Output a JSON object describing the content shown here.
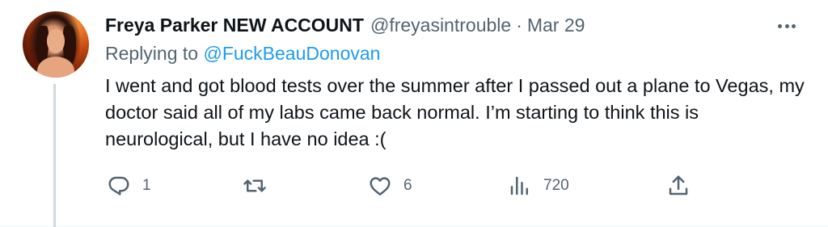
{
  "tweet": {
    "display_name": "Freya Parker NEW ACCOUNT",
    "handle": "@freyasintrouble",
    "separator": "·",
    "date": "Mar 29",
    "replying_prefix": "Replying to",
    "replying_to": "@FuckBeauDonovan",
    "text": "I went and got blood tests over the summer after I passed out a plane to Vegas, my doctor said all of my labs came back normal. I’m starting to think this is neurological, but I have no idea :("
  },
  "actions": {
    "reply_count": "1",
    "retweet_count": "",
    "like_count": "6",
    "view_count": "720"
  },
  "colors": {
    "text_primary": "#0f1419",
    "text_secondary": "#536471",
    "link": "#1d9bf0",
    "thread_line": "#cfd9de"
  },
  "icons": [
    "more-icon",
    "reply-icon",
    "retweet-icon",
    "like-icon",
    "views-icon",
    "share-icon"
  ]
}
